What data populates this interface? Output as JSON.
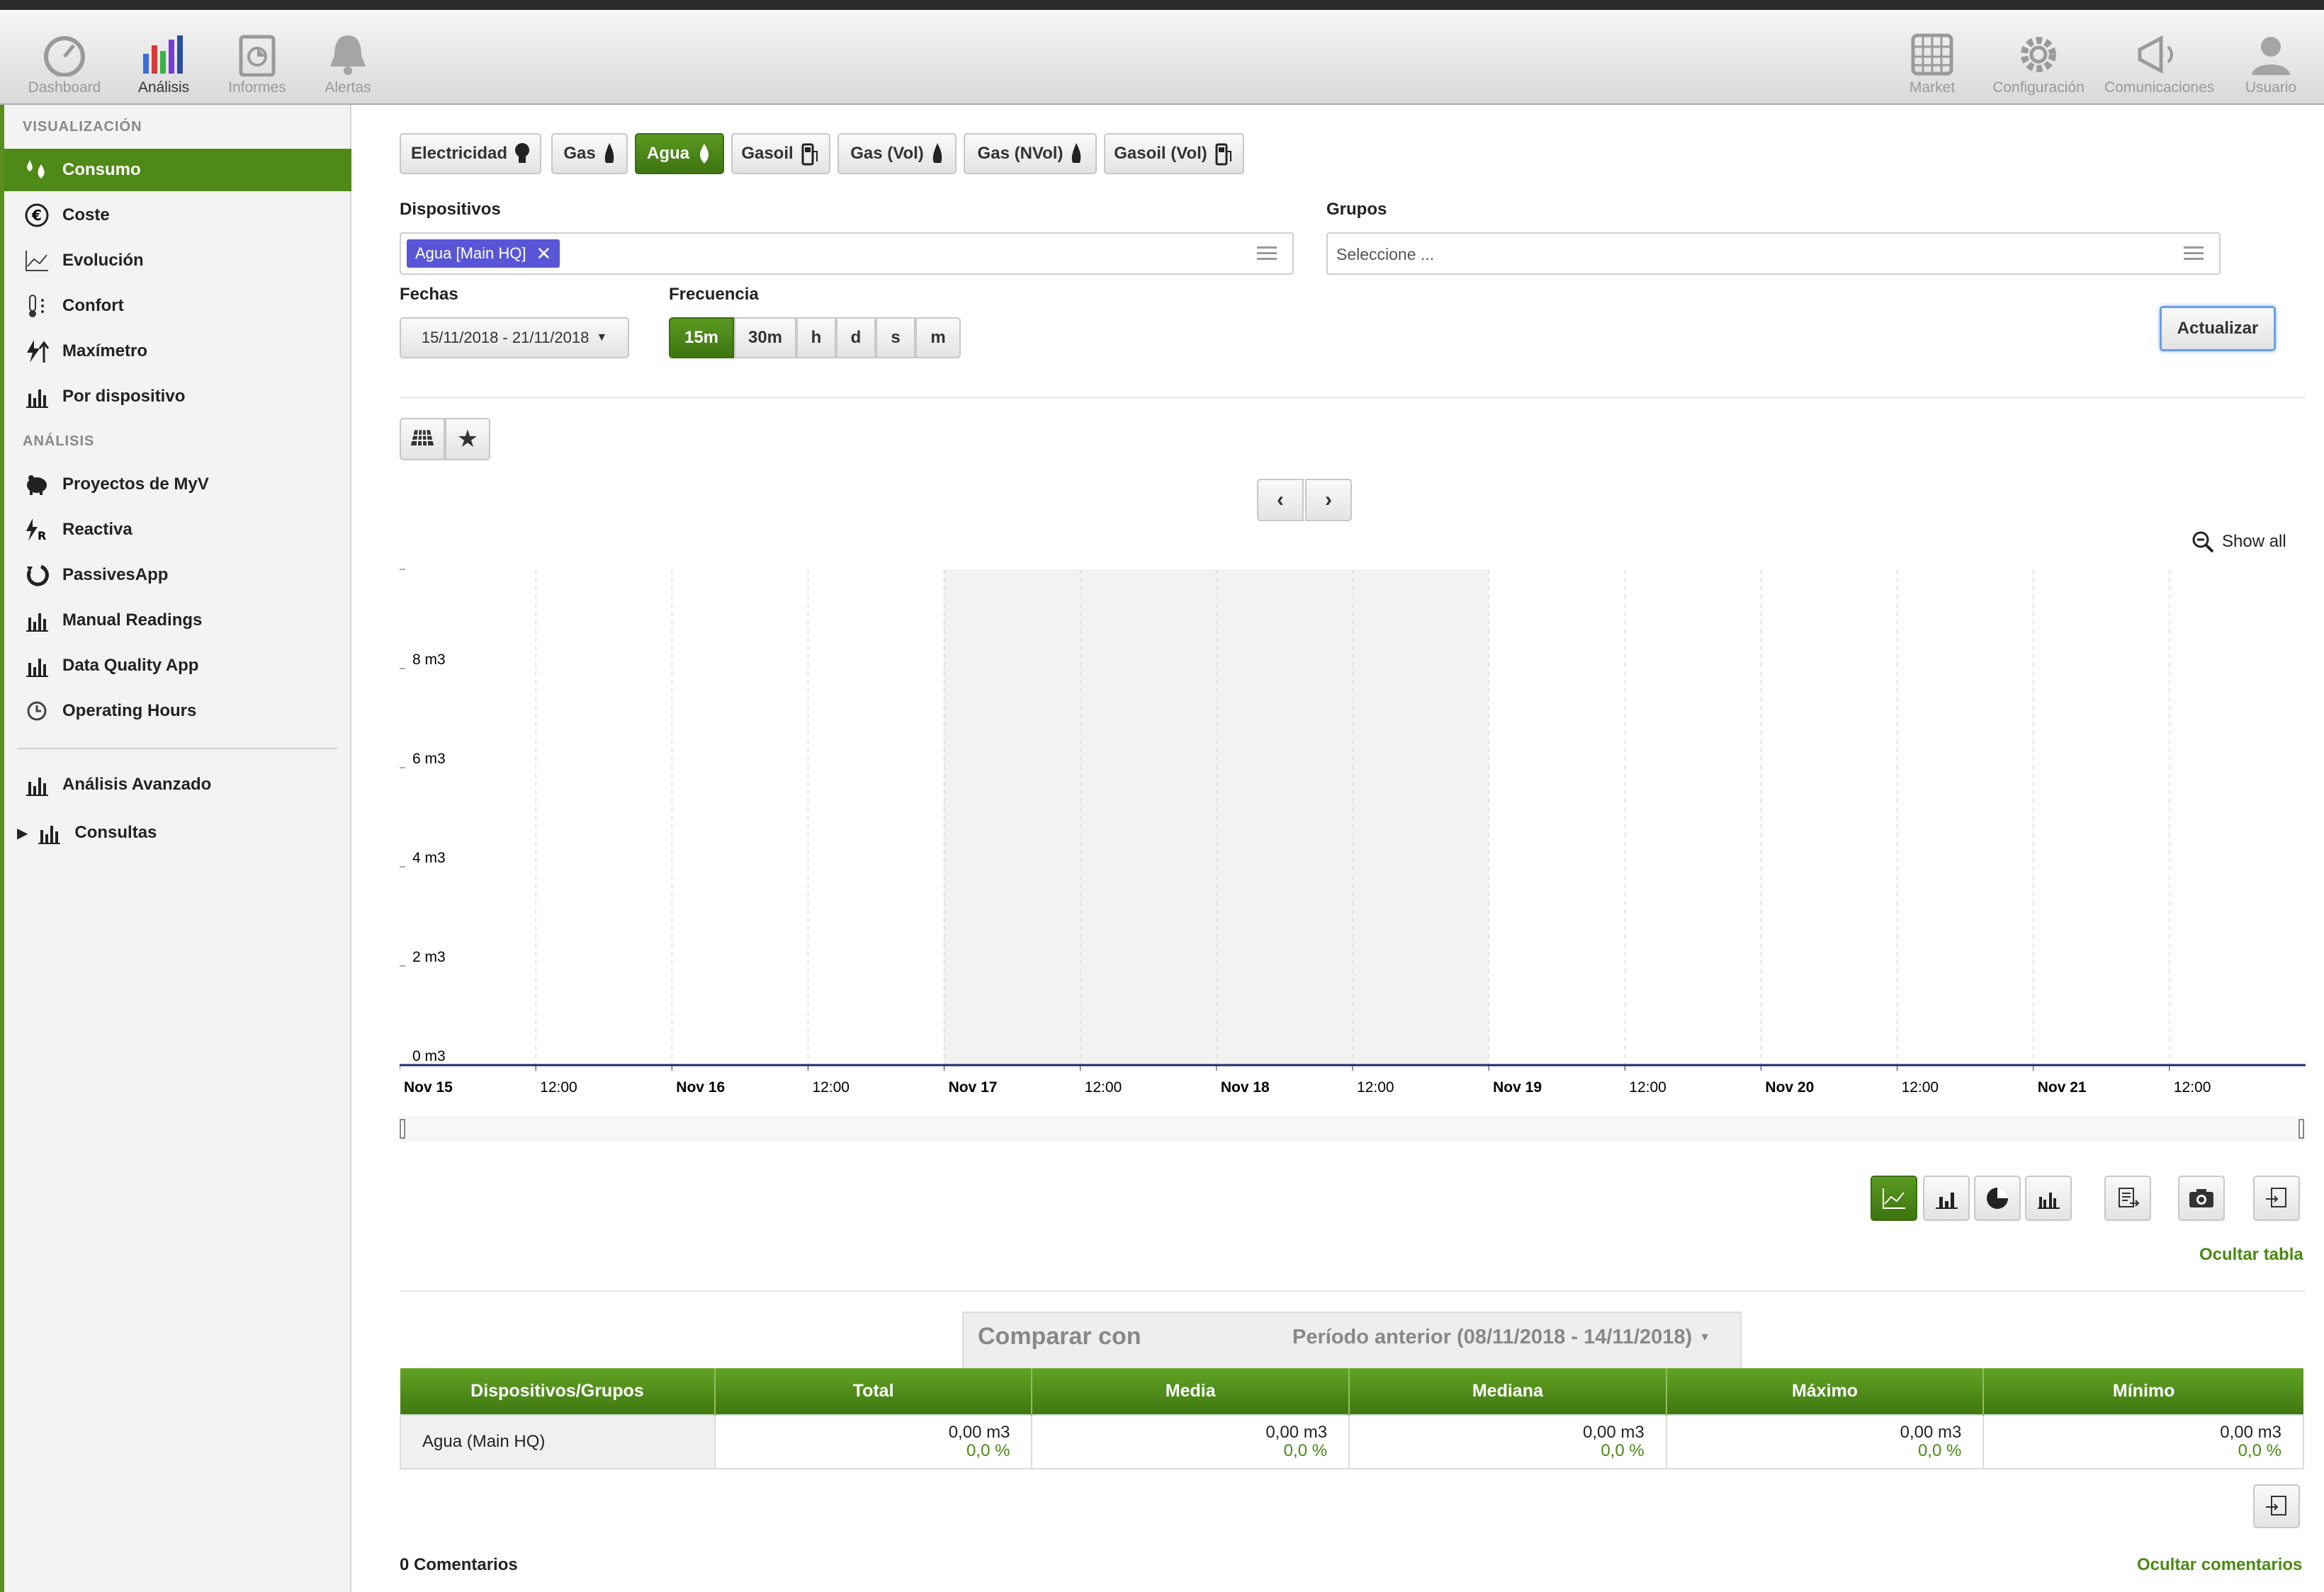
{
  "topbar": {
    "left": [
      {
        "label": "Dashboard",
        "icon": "dashboard-gauge-icon"
      },
      {
        "label": "Análisis",
        "icon": "analysis-bar-chart-icon",
        "active": true
      },
      {
        "label": "Informes",
        "icon": "reports-clipboard-icon"
      },
      {
        "label": "Alertas",
        "icon": "alerts-bell-icon"
      }
    ],
    "right": [
      {
        "label": "Market",
        "icon": "market-grid-icon"
      },
      {
        "label": "Configuración",
        "icon": "settings-gear-icon"
      },
      {
        "label": "Comunicaciones",
        "icon": "megaphone-icon"
      },
      {
        "label": "Usuario",
        "icon": "user-icon"
      }
    ]
  },
  "sidebar": {
    "section1": "VISUALIZACIÓN",
    "items1": [
      {
        "label": "Consumo",
        "icon": "water-drops-icon",
        "active": true
      },
      {
        "label": "Coste",
        "icon": "euro-icon"
      },
      {
        "label": "Evolución",
        "icon": "line-chart-icon"
      },
      {
        "label": "Confort",
        "icon": "thermometer-icon"
      },
      {
        "label": "Maxímetro",
        "icon": "bolt-up-icon"
      },
      {
        "label": "Por dispositivo",
        "icon": "bar-chart-icon"
      }
    ],
    "section2": "ANÁLISIS",
    "items2": [
      {
        "label": "Proyectos de MyV",
        "icon": "piggy-bank-icon"
      },
      {
        "label": "Reactiva",
        "icon": "reactive-bolt-icon"
      },
      {
        "label": "PassivesApp",
        "icon": "passives-icon"
      },
      {
        "label": "Manual Readings",
        "icon": "bar-chart-icon"
      },
      {
        "label": "Data Quality App",
        "icon": "bar-chart-icon"
      },
      {
        "label": "Operating Hours",
        "icon": "clock-icon"
      }
    ],
    "items3": [
      {
        "label": "Análisis Avanzado",
        "icon": "bar-chart-icon"
      },
      {
        "label": "Consultas",
        "icon": "bar-chart-icon"
      }
    ]
  },
  "energy_tabs": [
    {
      "label": "Electricidad",
      "icon": "bulb-icon"
    },
    {
      "label": "Gas",
      "icon": "flame-icon"
    },
    {
      "label": "Agua",
      "icon": "drop-icon",
      "active": true
    },
    {
      "label": "Gasoil",
      "icon": "fuel-pump-icon"
    },
    {
      "label": "Gas (Vol)",
      "icon": "flame-icon"
    },
    {
      "label": "Gas (NVol)",
      "icon": "flame-icon"
    },
    {
      "label": "Gasoil (Vol)",
      "icon": "fuel-pump-icon"
    }
  ],
  "filters": {
    "devices_label": "Dispositivos",
    "device_chip": "Agua [Main HQ]",
    "groups_label": "Grupos",
    "groups_placeholder": "Seleccione ...",
    "dates_label": "Fechas",
    "date_range": "15/11/2018 - 21/11/2018",
    "freq_label": "Frecuencia",
    "freq_options": [
      "15m",
      "30m",
      "h",
      "d",
      "s",
      "m"
    ],
    "freq_active": "15m",
    "update_button": "Actualizar"
  },
  "chart_toolbar": {
    "show_all": "Show all"
  },
  "chart_data": {
    "type": "line",
    "series": [
      {
        "name": "Agua (Main HQ)",
        "values": [
          0,
          0,
          0,
          0,
          0,
          0,
          0
        ]
      }
    ],
    "x": [
      "Nov 15",
      "Nov 16",
      "Nov 17",
      "Nov 18",
      "Nov 19",
      "Nov 20",
      "Nov 21"
    ],
    "x_ticks": [
      "Nov 15",
      "12:00",
      "Nov 16",
      "12:00",
      "Nov 17",
      "12:00",
      "Nov 18",
      "12:00",
      "Nov 19",
      "12:00",
      "Nov 20",
      "12:00",
      "Nov 21",
      "12:00"
    ],
    "y_ticks": [
      "0 m3",
      "2 m3",
      "4 m3",
      "6 m3",
      "8 m3"
    ],
    "ylim": [
      0,
      10
    ],
    "shaded_range": [
      "Nov 17",
      "Nov 19"
    ],
    "grid": true
  },
  "views": {
    "hide_table": "Ocultar tabla"
  },
  "compare": {
    "label": "Comparar con",
    "value": "Período anterior (08/11/2018 - 14/11/2018)"
  },
  "table": {
    "headers": [
      "Dispositivos/Grupos",
      "Total",
      "Media",
      "Mediana",
      "Máximo",
      "Mínimo"
    ],
    "rows": [
      {
        "name": "Agua (Main HQ)",
        "values": [
          "0,00 m3",
          "0,00 m3",
          "0,00 m3",
          "0,00 m3",
          "0,00 m3"
        ],
        "pcts": [
          "0,0 %",
          "0,0 %",
          "0,0 %",
          "0,0 %",
          "0,0 %"
        ]
      }
    ]
  },
  "comments": {
    "count_label": "0 Comentarios",
    "hide": "Ocultar comentarios"
  },
  "colors": {
    "accent": "#4f8a18",
    "chip": "#5856d6"
  }
}
